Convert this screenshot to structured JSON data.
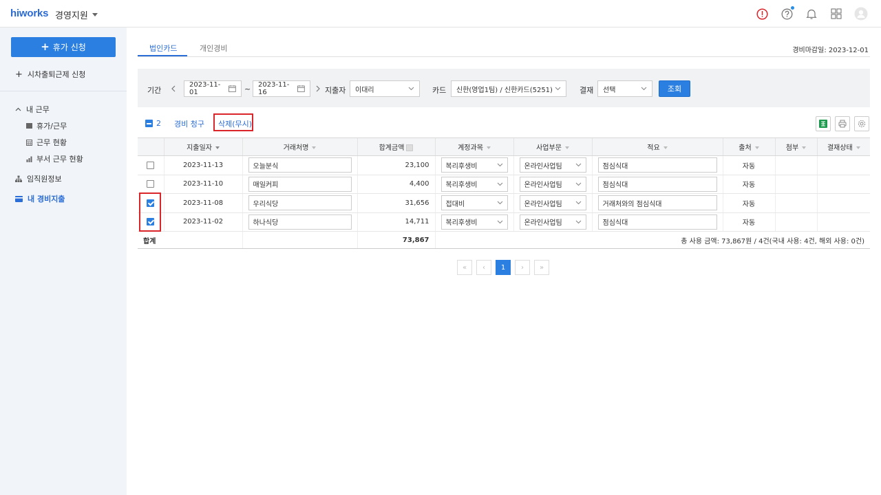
{
  "header": {
    "logo": "hiworks",
    "app_title": "경영지원",
    "icons": [
      "alert-icon",
      "help-icon",
      "bell-icon",
      "apps-grid-icon",
      "user-avatar"
    ]
  },
  "sidebar": {
    "primary_button": "휴가 신청",
    "link_commute": "시차출퇴근제 신청",
    "group_work": "내 근무",
    "sub_items": [
      "휴가/근무",
      "근무 현황",
      "부서 근무 현황"
    ],
    "employee_info": "임직원정보",
    "my_expense": "내 경비지출"
  },
  "tabs": [
    "법인카드",
    "개인경비"
  ],
  "deadline": "경비마감일: 2023-12-01",
  "filter": {
    "period_label": "기간",
    "date_from": "2023-11-01",
    "tilde": "~",
    "date_to": "2023-11-16",
    "spender_label": "지출자",
    "spender_value": "이대리",
    "card_label": "카드",
    "card_value": "신한(영업1팀) / 신한카드(5251)",
    "approval_label": "결재",
    "approval_value": "선택",
    "search_button": "조회"
  },
  "toolbar": {
    "selected_count": "2",
    "claim_link": "경비 청구",
    "delete_link": "삭제(무시)"
  },
  "table": {
    "headers": [
      "지출일자",
      "거래처명",
      "합계금액",
      "계정과목",
      "사업부문",
      "적요",
      "출처",
      "첨부",
      "결재상태"
    ],
    "rows": [
      {
        "checked": false,
        "date": "2023-11-13",
        "vendor": "오늘분식",
        "amount": "23,100",
        "account": "복리후생비",
        "division": "온라인사업팀",
        "memo": "점심식대",
        "source": "자동"
      },
      {
        "checked": false,
        "date": "2023-11-10",
        "vendor": "매일커피",
        "amount": "4,400",
        "account": "복리후생비",
        "division": "온라인사업팀",
        "memo": "점심식대",
        "source": "자동"
      },
      {
        "checked": true,
        "date": "2023-11-08",
        "vendor": "우리식당",
        "amount": "31,656",
        "account": "접대비",
        "division": "온라인사업팀",
        "memo": "거래처와의 점심식대",
        "source": "자동"
      },
      {
        "checked": true,
        "date": "2023-11-02",
        "vendor": "하나식당",
        "amount": "14,711",
        "account": "복리후생비",
        "division": "온라인사업팀",
        "memo": "점심식대",
        "source": "자동"
      }
    ],
    "sum_label": "합계",
    "sum_total": "73,867",
    "summary_text": "총 사용 금액: 73,867원 / 4건(국내 사용: 4건, 해외 사용: 0건)"
  },
  "pagination": {
    "current": "1",
    "first": "«",
    "prev": "‹",
    "next": "›",
    "last": "»"
  },
  "colors": {
    "accent": "#2b7fe0",
    "highlight_red": "#d9252a",
    "sidebar_bg": "#f1f4f9"
  }
}
